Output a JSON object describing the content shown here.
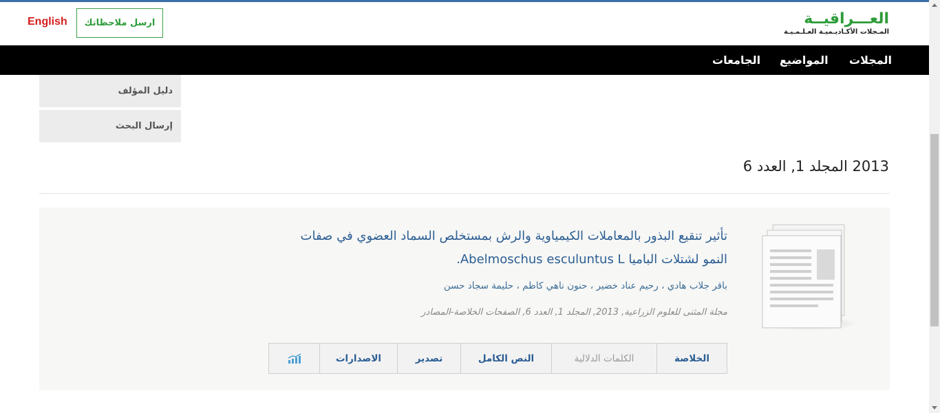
{
  "header": {
    "logo_main": "العـــراقيــة",
    "logo_sub": "المـجلات الأكـاديـميـة العـلـمـيـة",
    "feedback_label": "ارسل ملاحظاتك",
    "language_label": "English"
  },
  "nav": {
    "items": [
      {
        "label": "المجلات"
      },
      {
        "label": "المواضيع"
      },
      {
        "label": "الجامعات"
      }
    ]
  },
  "sidebar": {
    "items": [
      {
        "label": "دليل المؤلف"
      },
      {
        "label": "إرسال البحث"
      }
    ]
  },
  "issue": {
    "title": "2013 المجلد 1, العدد 6"
  },
  "article": {
    "title": "تأثير تنقيع البذور بالمعاملات الكيمياوية والرش بمستخلص السماد العضوي في صفات النمو لشتلات الباميا Abelmoschus esculuntus L.",
    "authors": "باقر جلاب هادي ، رحيم عناد خضير ، حنون ناهي كاظم ، حليمة سجاد حسن",
    "citation": "مجلة المثنى للعلوم الزراعية, 2013, المجلد 1, العدد 6, الصفحات الخلاصة-المصادر",
    "tabs": {
      "abstract": "الخلاصة",
      "keywords": "الكلمات الدلالية",
      "fulltext": "النص الكامل",
      "export": "تصدير",
      "releases": "الاصدارات"
    }
  },
  "icons": {
    "document": "document-stack-icon",
    "stats": "bar-chart-icon"
  },
  "colors": {
    "brand_green": "#2d9c3a",
    "nav_bg": "#000000",
    "link_blue": "#2a5d93",
    "english_red": "#d51c1c"
  }
}
